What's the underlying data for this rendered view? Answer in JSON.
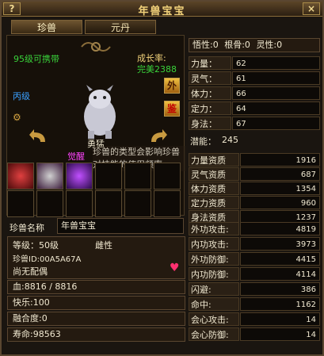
{
  "window": {
    "title": "年兽宝宝",
    "help": "?",
    "close": "×"
  },
  "tabs": [
    {
      "label": "珍兽",
      "active": true
    },
    {
      "label": "元丹",
      "active": false
    }
  ],
  "pet": {
    "level_text": "95级可携带",
    "growth_label": "成长率:",
    "growth_value": "完美2388",
    "grade": "丙级",
    "btn_outer": "外",
    "btn_appraise": "鉴",
    "temperament": "勇猛",
    "awaken_label": "觉醒",
    "tooltip_line1": "珍兽的类型会影响珍兽",
    "tooltip_line2": "对技能的使用频率",
    "name_label": "珍兽名称",
    "name_value": "年兽宝宝",
    "level_info": "等级：50级",
    "gender": "雌性",
    "pet_id": "珍兽ID:00A5A67A",
    "spouse": "尚无配偶",
    "hp": "血:8816 / 8816",
    "happiness": "快乐:100",
    "fusion": "融合度:0",
    "lifespan": "寿命:98563"
  },
  "topstats": {
    "wuxing": "悟性:0",
    "genggu": "根骨:0",
    "lingxing": "灵性:0"
  },
  "attrs": [
    {
      "label": "力量：",
      "value": "62"
    },
    {
      "label": "灵气：",
      "value": "61"
    },
    {
      "label": "体力：",
      "value": "66"
    },
    {
      "label": "定力：",
      "value": "64"
    },
    {
      "label": "身法：",
      "value": "67"
    }
  ],
  "potential": {
    "label": "潜能：",
    "value": "245"
  },
  "aptitudes": [
    {
      "label": "力量资质",
      "value": "1916"
    },
    {
      "label": "灵气资质",
      "value": "687"
    },
    {
      "label": "体力资质",
      "value": "1354"
    },
    {
      "label": "定力资质",
      "value": "960"
    },
    {
      "label": "身法资质",
      "value": "1237"
    }
  ],
  "combat": [
    {
      "label": "外功攻击:",
      "value": "4819"
    },
    {
      "label": "内功攻击:",
      "value": "3973"
    },
    {
      "label": "外功防御:",
      "value": "4415"
    },
    {
      "label": "内功防御:",
      "value": "4114"
    },
    {
      "label": "闪避:",
      "value": "386"
    },
    {
      "label": "命中:",
      "value": "1162"
    },
    {
      "label": "会心攻击:",
      "value": "14"
    },
    {
      "label": "会心防御:",
      "value": "14"
    }
  ],
  "colors": {
    "accent": "#f2d27a",
    "green": "#39d23a",
    "blue": "#3aa0ff",
    "pink": "#ff44ff"
  }
}
